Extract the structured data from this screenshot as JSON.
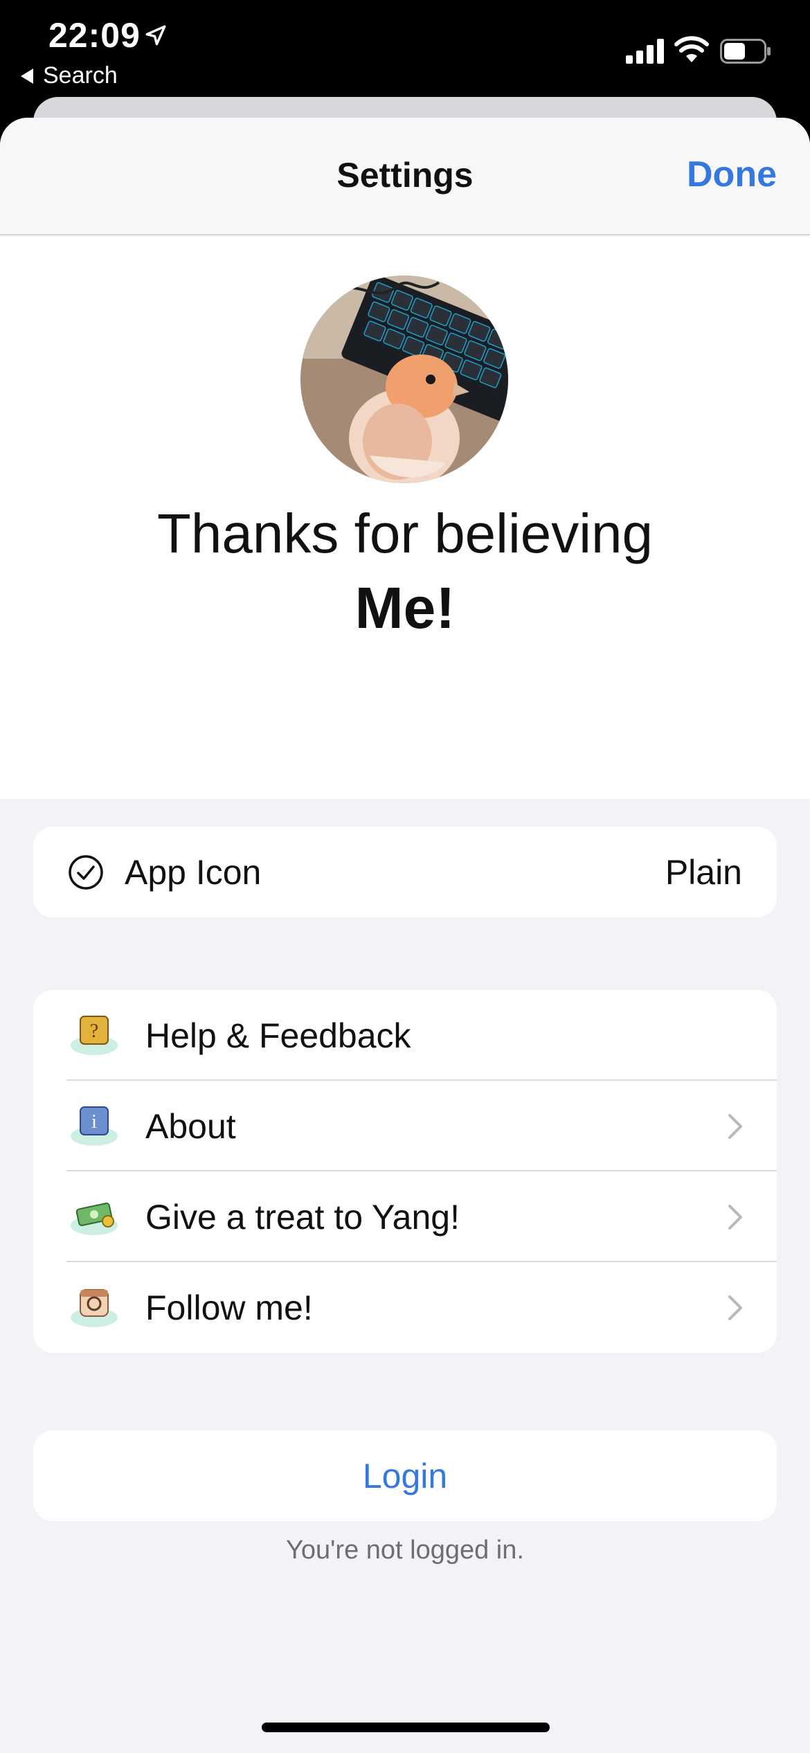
{
  "status_bar": {
    "time": "22:09",
    "back_label": "Search"
  },
  "nav": {
    "title": "Settings",
    "done_label": "Done"
  },
  "hero": {
    "line1": "Thanks for believing",
    "line2": "Me!"
  },
  "app_icon_row": {
    "label": "App Icon",
    "value": "Plain",
    "icon": "checkmark-circle-icon"
  },
  "menu": {
    "items": [
      {
        "label": "Help & Feedback",
        "icon": "help-question-icon",
        "chevron": false
      },
      {
        "label": "About",
        "icon": "info-icon",
        "chevron": true
      },
      {
        "label": "Give a treat to Yang!",
        "icon": "money-cloud-icon",
        "chevron": true
      },
      {
        "label": "Follow me!",
        "icon": "instagram-icon",
        "chevron": true
      }
    ]
  },
  "login": {
    "button_label": "Login",
    "status_text": "You're not logged in."
  },
  "colors": {
    "accent": "#3478e0",
    "background": "#f2f2f7"
  }
}
